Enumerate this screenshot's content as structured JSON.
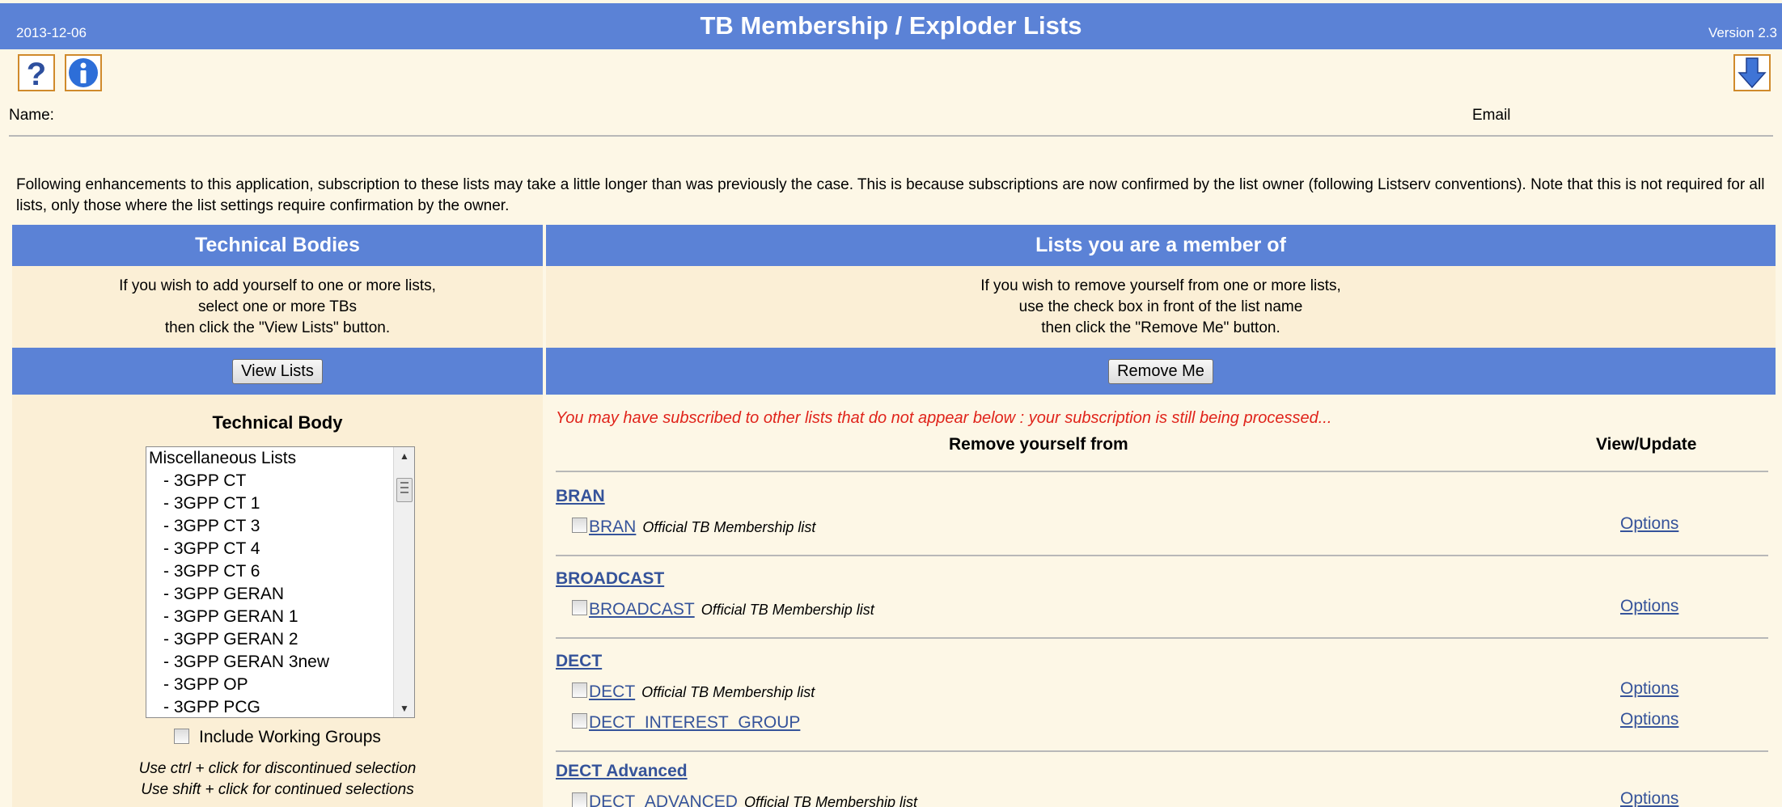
{
  "header": {
    "date": "2013-12-06",
    "title": "TB Membership / Exploder Lists",
    "version": "Version 2.3",
    "color": "#5b82d6"
  },
  "toolbar": {
    "icons": [
      "help-icon",
      "info-icon",
      "download-arrow-icon"
    ]
  },
  "user": {
    "name_label": "Name:",
    "email_label": "Email"
  },
  "notice": "Following enhancements to this application, subscription to these lists may take a little longer than was previously the case. This is because subscriptions are now confirmed by the list owner (following Listserv conventions). Note that this is not required for all lists, only those where the list settings require confirmation by the owner.",
  "left_panel": {
    "heading": "Technical Bodies",
    "instructions": [
      "If you wish to add yourself to one or more lists,",
      "select one or more TBs",
      "then click the \"View Lists\" button."
    ],
    "button_label": "View Lists",
    "select_title": "Technical Body",
    "list_items": [
      {
        "label": "Miscellaneous Lists",
        "sub": false
      },
      {
        "label": "-  3GPP CT",
        "sub": true
      },
      {
        "label": "-  3GPP CT 1",
        "sub": true
      },
      {
        "label": "-  3GPP CT 3",
        "sub": true
      },
      {
        "label": "-  3GPP CT 4",
        "sub": true
      },
      {
        "label": "-  3GPP CT 6",
        "sub": true
      },
      {
        "label": "-  3GPP GERAN",
        "sub": true
      },
      {
        "label": "-  3GPP GERAN 1",
        "sub": true
      },
      {
        "label": "-  3GPP GERAN 2",
        "sub": true
      },
      {
        "label": "-  3GPP GERAN 3new",
        "sub": true
      },
      {
        "label": "-  3GPP OP",
        "sub": true
      },
      {
        "label": "-  3GPP PCG",
        "sub": true
      }
    ],
    "include_wg_label": "Include Working Groups",
    "hint1": "Use ctrl + click for discontinued selection",
    "hint2": "Use shift + click for continued selections"
  },
  "right_panel": {
    "heading": "Lists you are a member of",
    "instructions": [
      "If you wish to remove yourself from one or more lists,",
      "use the check box in front of the list name",
      "then click the \"Remove Me\" button."
    ],
    "button_label": "Remove Me",
    "warning": "You may have subscribed to other lists that do not appear below : your subscription is still being processed...",
    "col_remove": "Remove yourself from",
    "col_view": "View/Update",
    "groups": [
      {
        "name": "BRAN",
        "entries": [
          {
            "list": "BRAN",
            "desc": "Official TB Membership list",
            "option": "Options"
          }
        ]
      },
      {
        "name": "BROADCAST",
        "entries": [
          {
            "list": "BROADCAST",
            "desc": "Official TB Membership list",
            "option": "Options"
          }
        ]
      },
      {
        "name": "DECT",
        "entries": [
          {
            "list": "DECT",
            "desc": "Official TB Membership list",
            "option": "Options"
          },
          {
            "list": "DECT_INTEREST_GROUP",
            "desc": "",
            "option": "Options"
          }
        ]
      },
      {
        "name": "DECT Advanced",
        "entries": [
          {
            "list": "DECT_ADVANCED",
            "desc": "Official TB Membership list",
            "option": "Options"
          }
        ]
      }
    ]
  }
}
